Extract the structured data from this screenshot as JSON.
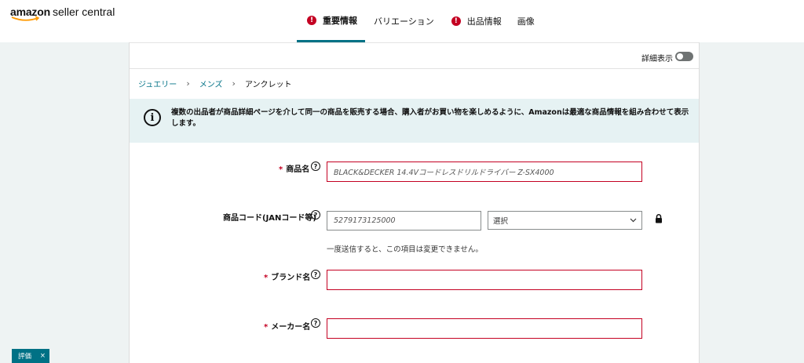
{
  "header": {
    "logo_brand": "amazon",
    "logo_sub": "seller central",
    "tabs": [
      {
        "label": "重要情報",
        "error": "!"
      },
      {
        "label": "バリエーション"
      },
      {
        "label": "出品情報",
        "error": "!"
      },
      {
        "label": "画像"
      }
    ]
  },
  "card": {
    "detail_label": "詳細表示",
    "breadcrumb": [
      "ジュエリー",
      "メンズ",
      "アンクレット"
    ],
    "breadcrumb_sep": "›",
    "info_text": "複数の出品者が商品詳細ページを介して同一の商品を販売する場合、購入者がお買い物を楽しめるように、Amazonは最適な商品情報を組み合わせて表示します。",
    "info_icon": "i",
    "help_glyph": "?",
    "required_mark": "*",
    "fields": {
      "product_name": {
        "label": "商品名",
        "value": "BLACK&DECKER 14.4Vコードレスドリルドライバー Z-SX4000"
      },
      "product_code": {
        "label": "商品コード(JANコード等)",
        "value": "5279173125000",
        "select_value": "選択",
        "note": "一度送信すると、この項目は変更できません。"
      },
      "brand": {
        "label": "ブランド名",
        "value": ""
      },
      "maker": {
        "label": "メーカー名",
        "value": ""
      }
    }
  },
  "feedback": {
    "label": "評価",
    "close": "×"
  }
}
